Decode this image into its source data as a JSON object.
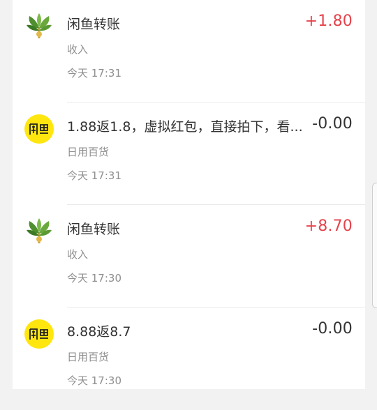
{
  "transactions": [
    {
      "title": "闲鱼转账",
      "category": "收入",
      "time": "今天 17:31",
      "amount": "+1.80",
      "icon": "plant-icon"
    },
    {
      "title": "1.88返1.8，虚拟红包，直接拍下，看...",
      "category": "日用百货",
      "time": "今天 17:31",
      "amount": "-0.00",
      "icon": "xianyu-logo-icon",
      "logo_text": "闲鱼"
    },
    {
      "title": "闲鱼转账",
      "category": "收入",
      "time": "今天 17:30",
      "amount": "+8.70",
      "icon": "plant-icon"
    },
    {
      "title": "8.88返8.7",
      "category": "日用百货",
      "time": "今天 17:30",
      "amount": "-0.00",
      "icon": "xianyu-logo-icon",
      "logo_text": "闲鱼"
    }
  ],
  "colors": {
    "income": "#e6424b",
    "expense": "#333333",
    "logo_bg": "#ffe60f"
  }
}
